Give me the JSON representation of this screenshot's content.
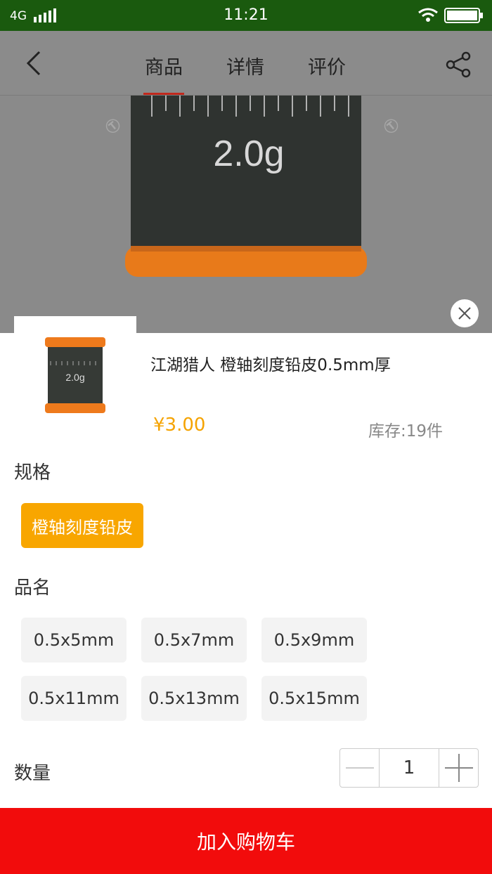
{
  "status": {
    "network": "4G",
    "time": "11:21"
  },
  "nav": {
    "tabs": [
      "商品",
      "详情",
      "评价"
    ]
  },
  "photo": {
    "weight_label": "2.0g"
  },
  "product": {
    "title": "江湖猎人 橙轴刻度铅皮0.5mm厚",
    "price": "¥3.00",
    "stock": "库存:19件"
  },
  "spec": {
    "label": "规格",
    "options": [
      "橙轴刻度铅皮"
    ],
    "selected": 0
  },
  "name": {
    "label": "品名",
    "options": [
      "0.5x5mm",
      "0.5x7mm",
      "0.5x9mm",
      "0.5x11mm",
      "0.5x13mm",
      "0.5x15mm"
    ]
  },
  "quantity": {
    "label": "数量",
    "value": "1"
  },
  "cart_button": "加入购物车",
  "colors": {
    "accent": "#f8a600",
    "cart": "#f20c0c",
    "status_bar": "#1a5a0e"
  }
}
